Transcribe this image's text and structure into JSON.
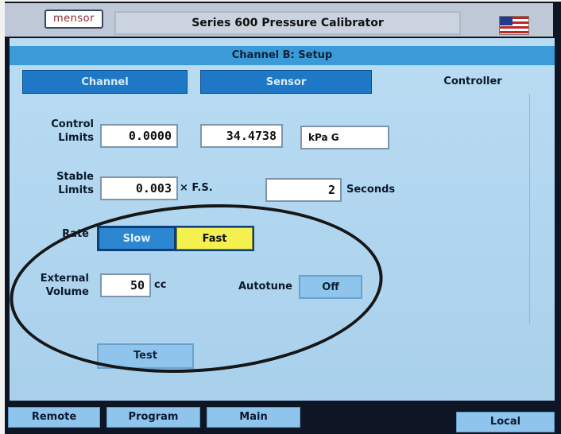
{
  "header": {
    "logo_text": "mensor",
    "title": "Series 600 Pressure Calibrator",
    "flag_icon": "us-flag-icon"
  },
  "channel_header": "Channel B: Setup",
  "tabs": [
    {
      "label": "Channel",
      "active": false
    },
    {
      "label": "Sensor",
      "active": false
    },
    {
      "label": "Controller",
      "active": true
    }
  ],
  "control_limits": {
    "label_line1": "Control",
    "label_line2": "Limits",
    "lower": "0.0000",
    "upper": "34.4738",
    "unit": "kPa G"
  },
  "stable_limits": {
    "label_line1": "Stable",
    "label_line2": "Limits",
    "value": "0.003",
    "value_suffix": "× F.S.",
    "seconds_value": "2",
    "seconds_label": "Seconds"
  },
  "rate": {
    "label": "Rate",
    "options": [
      "Slow",
      "Fast"
    ],
    "selected": "Fast"
  },
  "external_volume": {
    "label_line1": "External",
    "label_line2": "Volume",
    "value": "50",
    "unit": "cc"
  },
  "autotune": {
    "label": "Autotune",
    "value": "Off"
  },
  "test_button": "Test",
  "softkeys": [
    "Remote",
    "Program",
    "Main"
  ],
  "local_button": "Local",
  "colors": {
    "screen_bg": "#b9dcf2",
    "header_bar": "#3b9bd8",
    "tab_dark": "#1e78c6",
    "fast_selected": "#f4f050",
    "button_light": "#8fc4ec"
  }
}
